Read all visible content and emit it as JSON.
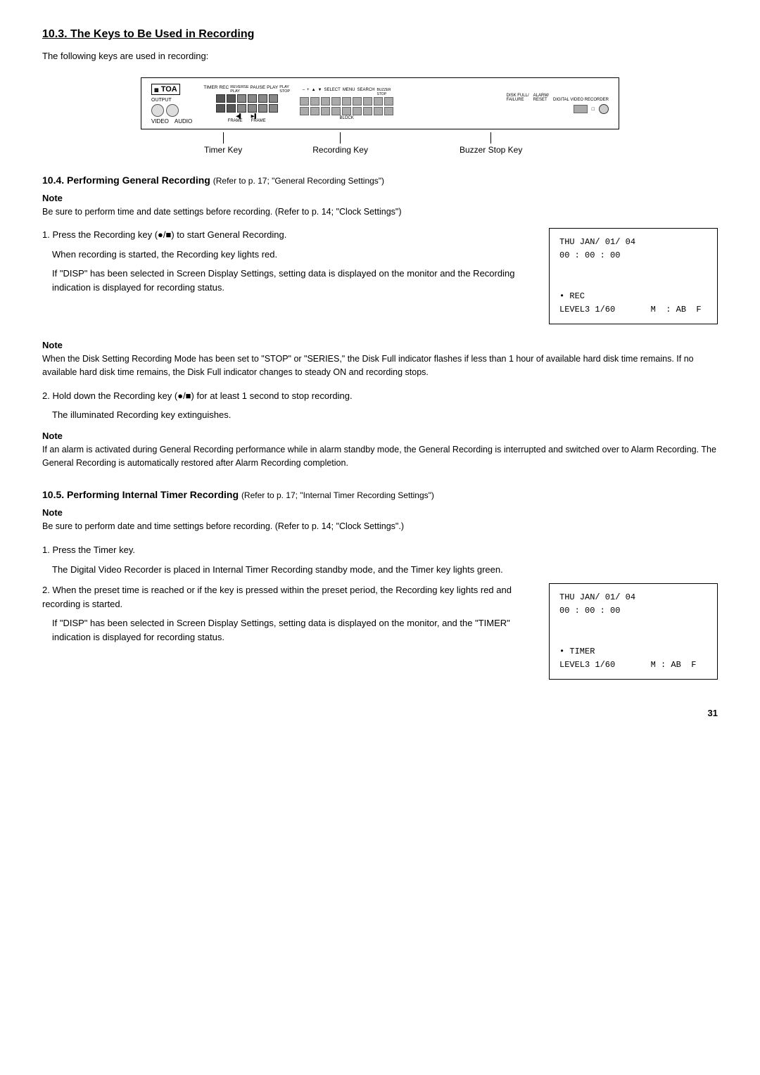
{
  "page": {
    "number": "31",
    "section_10_3": {
      "title": "10.3. The Keys to Be Used in Recording",
      "intro": "The following keys are used in recording:",
      "diagram": {
        "brand": "TOA",
        "output_label": "OUTPUT",
        "video_label": "VIDEO",
        "audio_label": "AUDIO",
        "keys": {
          "timer_key": "Timer Key",
          "recording_key": "Recording Key",
          "buzzer_stop_key": "Buzzer Stop Key"
        }
      }
    },
    "section_10_4": {
      "title": "10.4. Performing General Recording",
      "title_ref": "(Refer to p. 17; \"General Recording Settings\")",
      "note1_label": "Note",
      "note1_text": "Be sure to perform time and date settings before recording. (Refer to p. 14; \"Clock Settings\")",
      "step1_text_a": "1. Press the Recording key (●/■) to start General Recording.",
      "step1_text_b": "When recording is started, the Recording key lights red.",
      "step1_text_c": "If \"DISP\" has been selected in Screen Display Settings, setting data is displayed on the monitor and the Recording indication is displayed for recording status.",
      "display1": {
        "line1": "THU JAN/ 01/ 04",
        "line2": "00 : 00 : 00",
        "line3": "",
        "line4": "",
        "line5": "• REC",
        "line6": "LEVEL3 1/60       M  : AB  F"
      },
      "note2_label": "Note",
      "note2_text": "When the Disk Setting Recording Mode has been set to \"STOP\" or \"SERIES,\" the Disk Full indicator flashes if less than 1 hour of available hard disk time remains. If no available hard disk time remains, the Disk Full indicator changes to steady ON and recording stops.",
      "step2_text_a": "2. Hold down the Recording key (●/■) for at least 1 second to stop recording.",
      "step2_text_b": "The illuminated Recording key extinguishes.",
      "note3_label": "Note",
      "note3_text": "If an alarm is activated during General Recording performance while in alarm standby mode, the General Recording is interrupted and switched over to Alarm Recording. The General Recording is automatically restored after Alarm Recording completion."
    },
    "section_10_5": {
      "title": "10.5. Performing Internal Timer Recording",
      "title_ref": "(Refer to p. 17; \"Internal Timer Recording Settings\")",
      "note1_label": "Note",
      "note1_text": "Be sure to perform date and time settings before recording. (Refer to p. 14; \"Clock Settings\".)",
      "step1_text_a": "1. Press the Timer key.",
      "step1_text_b": "The Digital Video Recorder is placed in Internal Timer Recording standby mode, and the Timer key lights green.",
      "step2_text_a": "2. When the preset time is reached or if the key is pressed within the preset period, the Recording key lights red and recording is started.",
      "step2_text_b": "If \"DISP\" has been selected in Screen Display Settings, setting data is displayed on the monitor, and the \"TIMER\" indication is displayed for recording status.",
      "display2": {
        "line1": "THU JAN/ 01/ 04",
        "line2": "00 : 00 : 00",
        "line3": "",
        "line4": "",
        "line5": "• TIMER",
        "line6": "LEVEL3 1/60       M : AB  F"
      }
    }
  }
}
